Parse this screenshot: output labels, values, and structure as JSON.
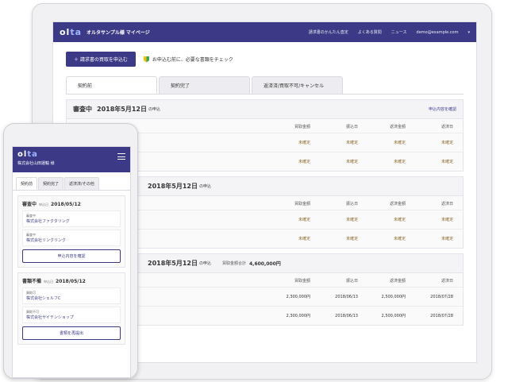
{
  "header": {
    "logo": "ol",
    "logo_accent": "ta",
    "site_title": "オルタサンプル様 マイページ",
    "nav": [
      "請求書のかんたん査定",
      "よくある質問",
      "ニュース",
      "demo@example.com",
      "▾"
    ]
  },
  "actions": {
    "primary_button": "＋ 請求書の買取を申込む",
    "hint": "お申込む前に、必要な書類をチェック"
  },
  "tabs": [
    "契約前",
    "契約完了",
    "返済済/買取不可/キャンセル"
  ],
  "cards": [
    {
      "status": "審査中",
      "date": "2018年5月12日",
      "date_suffix": "の申込",
      "total_label": "",
      "total_value": "",
      "link": "申込内容を確認",
      "columns": [
        "買取金額",
        "振込日",
        "返済金額",
        "返済日"
      ],
      "rows": [
        [
          "未確定",
          "未確定",
          "未確定",
          "未確定"
        ],
        [
          "未確定",
          "未確定",
          "未確定",
          "未確定"
        ]
      ]
    },
    {
      "status": "",
      "date": "2018年5月12日",
      "date_suffix": "の申込",
      "total_label": "",
      "total_value": "",
      "link": "",
      "columns": [
        "買取金額",
        "振込日",
        "返済金額",
        "返済日"
      ],
      "rows": [
        [
          "未確定",
          "未確定",
          "未確定",
          "未確定"
        ],
        [
          "未確定",
          "未確定",
          "未確定",
          "未確定"
        ]
      ]
    },
    {
      "status": "",
      "date": "2018年5月12日",
      "date_suffix": "の申込",
      "total_label": "買取金額合計",
      "total_value": "4,600,000円",
      "link": "",
      "columns": [
        "買取金額",
        "振込日",
        "返済金額",
        "返済日"
      ],
      "rows": [
        [
          "2,300,000円",
          "2018/06/13",
          "2,500,000円",
          "2018/07/28"
        ],
        [
          "2,300,000円",
          "2018/06/13",
          "2,500,000円",
          "2018/07/28"
        ]
      ]
    }
  ],
  "phone": {
    "logo": "ol",
    "logo_accent": "ta",
    "company": "株式会社山田運輸 様",
    "tabs": [
      "契約前",
      "契約完了",
      "返済済/その他"
    ],
    "cards": [
      {
        "status": "審査中",
        "date_label": "申込日",
        "date": "2018/05/12",
        "fields": [
          {
            "label": "審査中",
            "value": "株式会社ファクタリング"
          },
          {
            "label": "審査中",
            "value": "株式会社リンクリンク"
          }
        ],
        "button": "申込内容を確認"
      },
      {
        "status": "書類不備",
        "date_label": "申込日",
        "date": "2018/05/12",
        "fields": [
          {
            "label": "買取可",
            "value": "株式会社シェルフC"
          },
          {
            "label": "買取不可",
            "value": "株式会社サイテンショップ"
          }
        ],
        "button": "書類を再提出"
      }
    ]
  }
}
